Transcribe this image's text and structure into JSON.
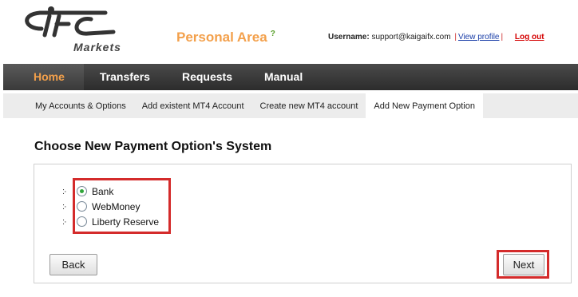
{
  "header": {
    "logo_text": "IFC",
    "logo_subtext": "Markets",
    "personal_area": "Personal Area",
    "help_mark": "?",
    "username_label": "Username:",
    "username": "support@kaigaifx.com",
    "view_profile": "View profile",
    "separator": "|",
    "logout": "Log out"
  },
  "main_nav": [
    {
      "label": "Home",
      "active": true
    },
    {
      "label": "Transfers",
      "active": false
    },
    {
      "label": "Requests",
      "active": false
    },
    {
      "label": "Manual",
      "active": false
    }
  ],
  "sub_nav": [
    {
      "label": "My Accounts & Options",
      "active": false
    },
    {
      "label": "Add existent MT4 Account",
      "active": false
    },
    {
      "label": "Create new MT4 account",
      "active": false
    },
    {
      "label": "Add New Payment Option",
      "active": true
    }
  ],
  "page": {
    "title": "Choose New Payment Option's System",
    "options": [
      {
        "bullet": ":·",
        "label": "Bank",
        "selected": true
      },
      {
        "bullet": ":·",
        "label": "WebMoney",
        "selected": false
      },
      {
        "bullet": ":·",
        "label": "Liberty Reserve",
        "selected": false
      }
    ],
    "back_label": "Back",
    "next_label": "Next"
  },
  "colors": {
    "accent_orange": "#f3a04b",
    "highlight_red": "#d42b2b",
    "nav_dark": "#2c2c2c",
    "radio_selected": "#2fa53a"
  }
}
